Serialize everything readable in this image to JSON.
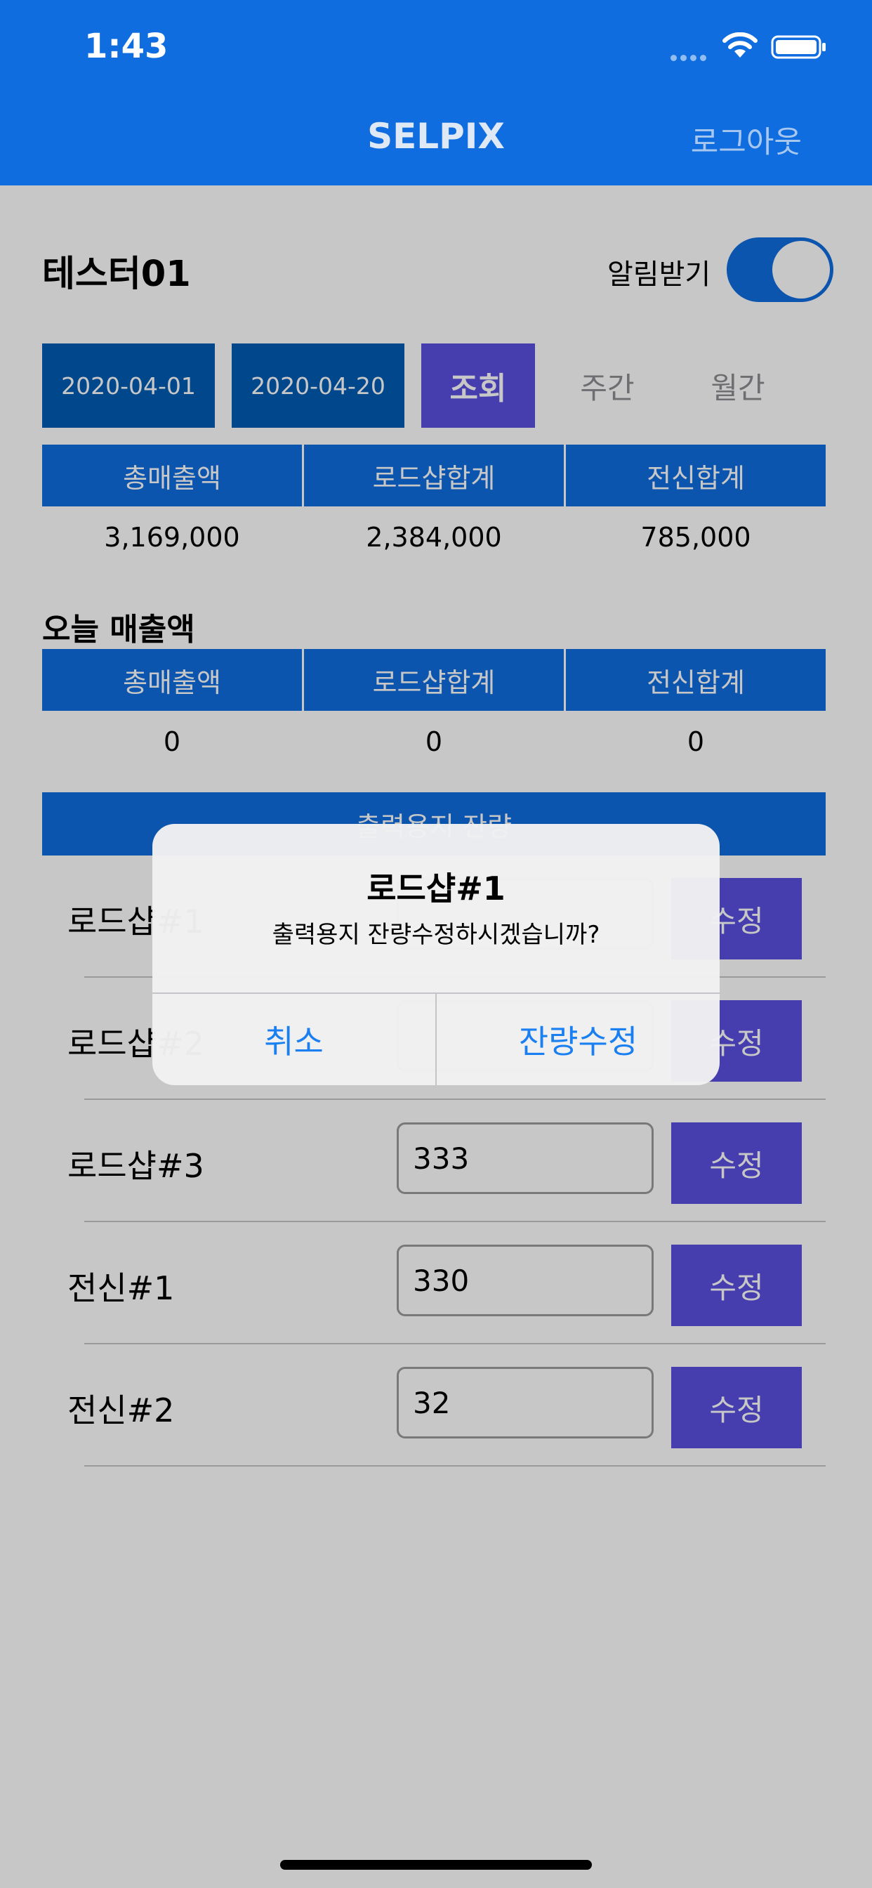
{
  "status_bar": {
    "time": "1:43"
  },
  "header": {
    "title": "SELPIX",
    "logout_label": "로그아웃"
  },
  "user": {
    "name": "테스터01",
    "alarm_label": "알림받기",
    "alarm_on": true
  },
  "filters": {
    "start_date": "2020-04-01",
    "end_date": "2020-04-20",
    "search_label": "조회",
    "weekly_label": "주간",
    "monthly_label": "월간"
  },
  "period_totals": {
    "headers": [
      "총매출액",
      "로드샵합계",
      "전신합계"
    ],
    "values": [
      "3,169,000",
      "2,384,000",
      "785,000"
    ]
  },
  "today_sales": {
    "title": "오늘 매출액",
    "headers": [
      "총매출액",
      "로드샵합계",
      "전신합계"
    ],
    "values": [
      "0",
      "0",
      "0"
    ]
  },
  "paper_stock": {
    "title": "출력용지 잔량",
    "edit_label": "수정",
    "rows": [
      {
        "name": "로드샵#1",
        "value": ""
      },
      {
        "name": "로드샵#2",
        "value": ""
      },
      {
        "name": "로드샵#3",
        "value": "333"
      },
      {
        "name": "전신#1",
        "value": "330"
      },
      {
        "name": "전신#2",
        "value": "32"
      }
    ]
  },
  "alert": {
    "title": "로드샵#1",
    "message": "출력용지 잔량수정하시겠습니까?",
    "cancel_label": "취소",
    "confirm_label": "잔량수정",
    "accent_color": "#1a7ff0"
  },
  "colors": {
    "primary": "#0f6de0",
    "date_button": "#005bb4",
    "action": "#5a4fe0"
  }
}
